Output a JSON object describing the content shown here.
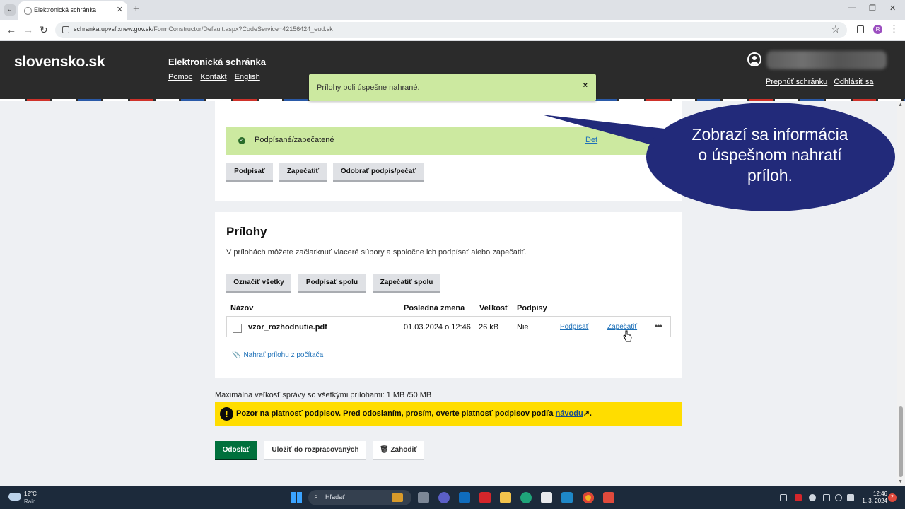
{
  "browser": {
    "tab_title": "Elektronická schránka",
    "tab_close": "✕",
    "new_tab": "+",
    "url_host": "schranka.upvsfixnew.gov.sk",
    "url_path": "/FormConstructor/Default.aspx?CodeService=42156424_eud.sk",
    "profile_initial": "R",
    "win_minimize": "—",
    "win_restore": "❐",
    "win_close": "✕",
    "back": "←",
    "forward": "→",
    "reload": "↻",
    "star": "☆",
    "menu": "⋮",
    "tab_list": "⌄"
  },
  "header": {
    "logo": "slovensko.sk",
    "service_title": "Elektronická schránka",
    "links": [
      "Pomoc",
      "Kontakt",
      "English"
    ],
    "switch_box": "Prepnúť schránku",
    "logout": "Odhlásiť sa"
  },
  "toast": {
    "message": "Prílohy boli úspešne nahrané.",
    "close": "×",
    "bg_color": "#cce9a0"
  },
  "signature": {
    "status": "Podpísané/zapečatené",
    "detail_link": "Det",
    "buttons": {
      "sign": "Podpísať",
      "seal": "Zapečatiť",
      "remove": "Odobrať podpis/pečať"
    }
  },
  "attachments": {
    "title": "Prílohy",
    "description": "V prílohách môžete začiarknuť viaceré súbory a spoločne ich podpísať alebo zapečatiť.",
    "buttons": {
      "select_all": "Označiť všetky",
      "sign_together": "Podpísať spolu",
      "seal_together": "Zapečatiť spolu"
    },
    "columns": [
      "Názov",
      "Posledná zmena",
      "Veľkosť",
      "Podpisy"
    ],
    "rows": [
      {
        "name": "vzor_rozhodnutie.pdf",
        "modified": "01.03.2024 o 12:46",
        "size": "26 kB",
        "signatures": "Nie",
        "sign_link": "Podpísať",
        "seal_link": "Zapečatiť",
        "more": "•••"
      }
    ],
    "upload_icon": "📎",
    "upload_link": "Nahrať prílohu z počítača"
  },
  "footer": {
    "max_size": "Maximálna veľkosť správy so všetkými prílohami: 1 MB /50 MB",
    "warning_icon": "!",
    "warning_text": "Pozor na platnosť podpisov. Pred odoslaním, prosím, overte platnosť podpisov podľa",
    "warning_link": "návodu",
    "warning_link_ext": "↗",
    "warning_end": ".",
    "send": "Odoslať",
    "save_draft": "Uložiť do rozpracovaných",
    "discard": "Zahodiť",
    "discard_icon": "🗑"
  },
  "callout": {
    "line1": "Zobrazí sa informácia",
    "line2": "o úspešnom nahratí",
    "line3": "príloh.",
    "color": "#222a7a"
  },
  "taskbar": {
    "weather_temp": "12°C",
    "weather_desc": "Rain",
    "search_icon": "⌕",
    "search_placeholder": "Hľadať",
    "time": "12:46",
    "date": "1. 3. 2024",
    "notifications": "2"
  },
  "colors": {
    "header_bg": "#2b2b2b",
    "link_blue": "#1d70b8",
    "send_green": "#00703c",
    "warning_yellow": "#ffdd00"
  }
}
